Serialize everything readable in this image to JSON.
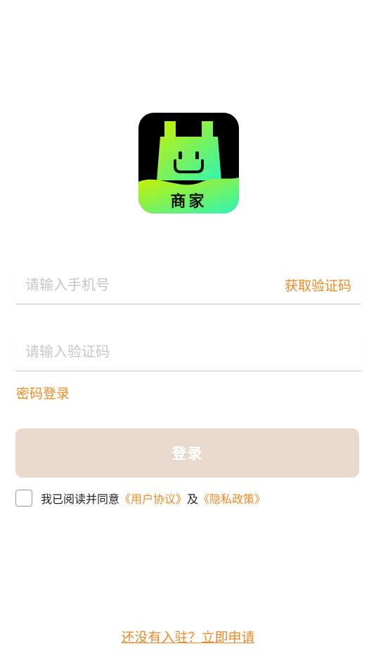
{
  "logo": {
    "icon": "shopping-bag-smile-icon",
    "text": "商家",
    "colors": {
      "background": "#000000",
      "gradient_start": "#c8f000",
      "gradient_end": "#2ef5b4"
    }
  },
  "form": {
    "phone_placeholder": "请输入手机号",
    "get_code_label": "获取验证码",
    "code_placeholder": "请输入验证码",
    "password_login_label": "密码登录",
    "login_button_label": "登录"
  },
  "agreement": {
    "checked": false,
    "prefix": "我已阅读并同意",
    "user_agreement": "《用户协议》",
    "conjunction": "及",
    "privacy_policy": "《隐私政策》"
  },
  "footer": {
    "apply_link": "还没有入驻？立即申请"
  },
  "theme": {
    "accent": "#ee8a23",
    "button_disabled_bg": "#e8d9cc",
    "placeholder": "#c6c6c8"
  }
}
